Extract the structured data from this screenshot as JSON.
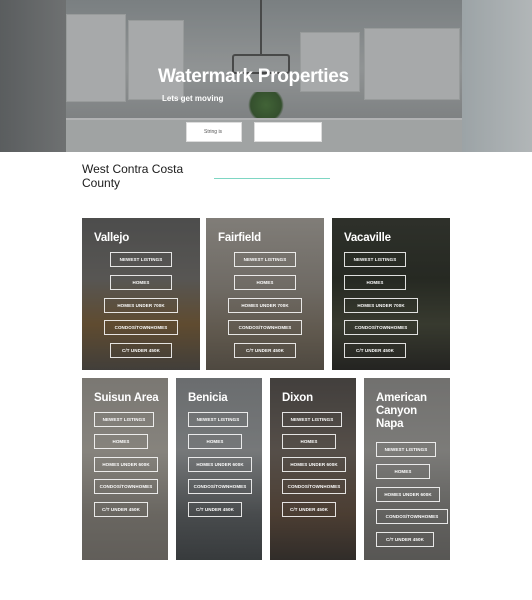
{
  "hero": {
    "title": "Watermark Properties",
    "subtitle": "Lets get moving",
    "input_value": "String is",
    "button_label": ""
  },
  "section": {
    "title": "West Contra Costa County"
  },
  "colors": {
    "accent_line": "#7ed6c3",
    "button_border": "#ffffff",
    "text_dark": "#1b1b1b"
  },
  "cards": [
    {
      "name": "Vallejo",
      "buttons": [
        "NEWEST LISTINGS",
        "HOMES",
        "HOMES UNDER 700K",
        "CONDOS/TOWNHOMES",
        "C/T UNDER 450K"
      ]
    },
    {
      "name": "Fairfield",
      "buttons": [
        "NEWEST LISTINGS",
        "HOMES",
        "HOMES UNDER 700K",
        "CONDOS/TOWNHOMES",
        "C/T UNDER 450K"
      ]
    },
    {
      "name": "Vacaville",
      "buttons": [
        "NEWEST LISTINGS",
        "HOMES",
        "HOMES UNDER 700K",
        "CONDOS/TOWNHOMES",
        "C/T UNDER 450K"
      ]
    },
    {
      "name": "Suisun Area",
      "buttons": [
        "NEWEST LISTINGS",
        "HOMES",
        "HOMES UNDER 600K",
        "CONDOS/TOWNHOMES",
        "C/T UNDER 450K"
      ]
    },
    {
      "name": "Benicia",
      "buttons": [
        "NEWEST LISTINGS",
        "HOMES",
        "HOMES UNDER 600K",
        "CONDOS/TOWNHOMES",
        "C/T UNDER 450K"
      ]
    },
    {
      "name": "Dixon",
      "buttons": [
        "NEWEST LISTINGS",
        "HOMES",
        "HOMES UNDER 600K",
        "CONDOS/TOWNHOMES",
        "C/T UNDER 450K"
      ]
    },
    {
      "name": "American Canyon Napa",
      "buttons": [
        "NEWEST LISTINGS",
        "HOMES",
        "HOMES UNDER 600K",
        "CONDOS/TOWNHOMES",
        "C/T UNDER 450K"
      ]
    }
  ]
}
